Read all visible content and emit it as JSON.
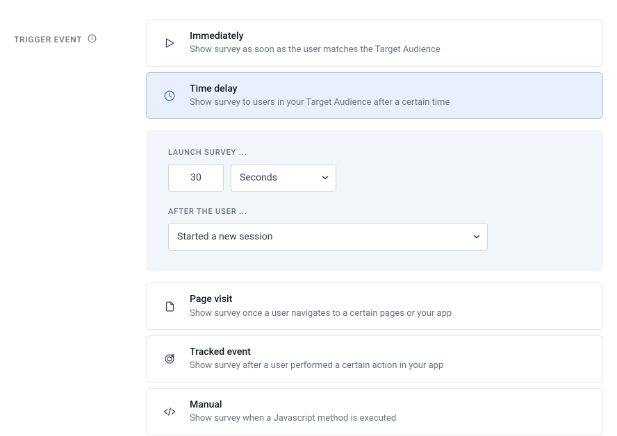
{
  "section": {
    "label": "TRIGGER EVENT"
  },
  "options": {
    "immediately": {
      "title": "Immediately",
      "desc": "Show survey as soon as the user matches the Target Audience"
    },
    "time_delay": {
      "title": "Time delay",
      "desc": "Show survey to users in your Target Audience after a certain time"
    },
    "page_visit": {
      "title": "Page visit",
      "desc": "Show survey once a user navigates to a certain pages or your app"
    },
    "tracked_event": {
      "title": "Tracked event",
      "desc": "Show survey after a user performed a certain action in your app"
    },
    "manual": {
      "title": "Manual",
      "desc": "Show survey when a Javascript method is executed"
    }
  },
  "config": {
    "launch_label": "LAUNCH SURVEY ...",
    "delay_value": "30",
    "unit_selected": "Seconds",
    "after_label": "AFTER THE USER ...",
    "after_selected": "Started a new session"
  }
}
